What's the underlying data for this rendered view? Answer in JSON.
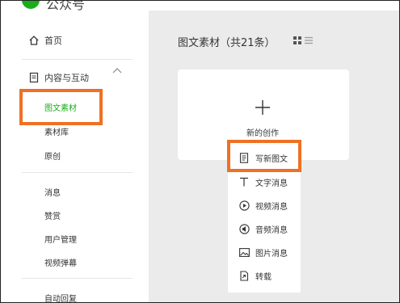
{
  "logo": {
    "text": "公众号"
  },
  "sidebar": {
    "home": "首页",
    "content_section": "内容与互动",
    "sub_items": [
      "图文素材",
      "素材库",
      "原创"
    ],
    "group2": [
      "消息",
      "赞赏",
      "用户管理",
      "视频弹幕"
    ],
    "group3": [
      "自动回复"
    ]
  },
  "main": {
    "title": "图文素材",
    "count_label": "（共21条）",
    "create_card_label": "新的创作",
    "create_menu": [
      {
        "label": "写新图文",
        "icon": "document-icon"
      },
      {
        "label": "文字消息",
        "icon": "text-T-icon"
      },
      {
        "label": "视频消息",
        "icon": "play-circle-icon"
      },
      {
        "label": "音频消息",
        "icon": "audio-icon"
      },
      {
        "label": "图片消息",
        "icon": "image-icon"
      },
      {
        "label": "转载",
        "icon": "repost-icon"
      }
    ]
  },
  "colors": {
    "accent_green": "#1aad19",
    "highlight_orange": "#ee7123",
    "background": "#ebebeb"
  }
}
